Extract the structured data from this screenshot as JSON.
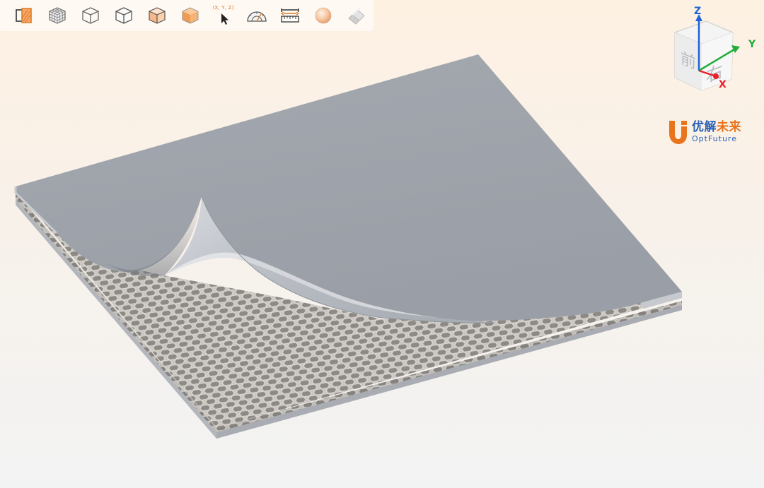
{
  "toolbar": {
    "tools": [
      {
        "name": "section-view-icon",
        "active": true
      },
      {
        "name": "mesh-view-icon"
      },
      {
        "name": "wireframe-cube-icon"
      },
      {
        "name": "edge-cube-icon"
      },
      {
        "name": "shaded-edge-cube-icon"
      },
      {
        "name": "shaded-cube-icon"
      },
      {
        "name": "pick-point-icon",
        "label": "(X, Y, Z)"
      },
      {
        "name": "protractor-icon"
      },
      {
        "name": "ruler-icon"
      },
      {
        "name": "sphere-material-icon"
      },
      {
        "name": "eraser-icon"
      }
    ],
    "accent": "#e07b1f"
  },
  "view_cube": {
    "axes": {
      "z": "Z",
      "y": "Y",
      "x": "X"
    },
    "faces": {
      "front": "前",
      "right": "右"
    },
    "colors": {
      "x": "#e8202a",
      "y": "#1fae3a",
      "z": "#1f63d6"
    }
  },
  "logo": {
    "cn_part1": "优解",
    "cn_part2": "未来",
    "en": "OptFuture",
    "colors": {
      "blue": "#2a62b8",
      "orange": "#e9741e"
    }
  },
  "model": {
    "description_visible": false,
    "colors": {
      "skin": "#9ea3ab",
      "core": "#b9b6b1",
      "edge": "#c4c7cc"
    }
  }
}
